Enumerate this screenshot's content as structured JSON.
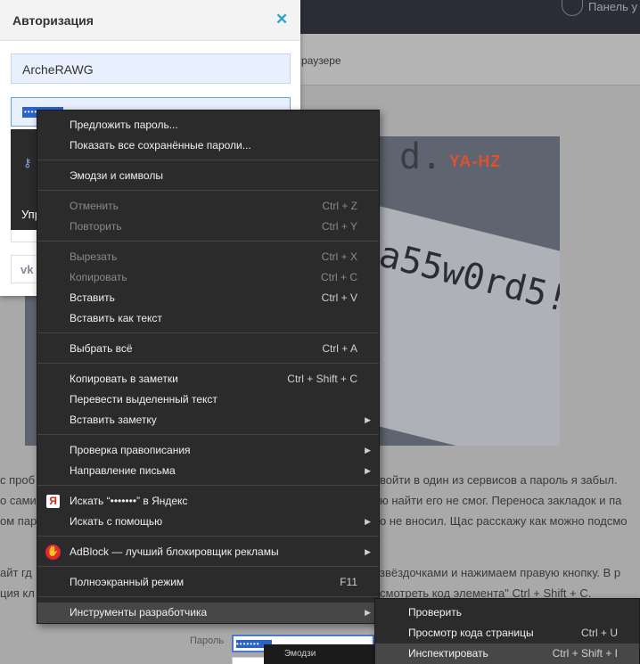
{
  "topbar": {
    "panel_link": "Панель у"
  },
  "page": {
    "tab_text": "раузере",
    "image": {
      "watermark": "YA-HZ",
      "password_text": "a55w0rd5!",
      "partial_text": "d."
    },
    "paragraphs": [
      {
        "left": "с проб",
        "right": "войти в один из сервисов а пароль я забыл."
      },
      {
        "left": "о сами",
        "right": "ю найти его не смог. Переноса закладок и па"
      },
      {
        "left": "ом пар",
        "right": "о не вносил. Щас расскажу как можно подсмо"
      },
      {
        "left": "айт гд",
        "right": "звёздочками и нажимаем правую кнопку. В р"
      },
      {
        "left": "ция кл",
        "right": "смотреть код элемента\" Ctrl + Shift + C."
      }
    ],
    "form_label": "Пароль",
    "emoji_tooltip": "Эмодзи"
  },
  "dialog": {
    "title": "Авторизация",
    "close_icon": "close-icon",
    "login_value": "ArcheRAWG",
    "password_value": "•••••••",
    "vk_label": "vk",
    "autofill_manage": "Упр"
  },
  "context_menu": {
    "items": [
      {
        "label": "Предложить пароль...",
        "shortcut": ""
      },
      {
        "label": "Показать все сохранённые пароли...",
        "shortcut": ""
      },
      {
        "label": "Эмодзи и символы",
        "shortcut": ""
      },
      {
        "label": "Отменить",
        "shortcut": "Ctrl + Z",
        "disabled": true
      },
      {
        "label": "Повторить",
        "shortcut": "Ctrl + Y",
        "disabled": true
      },
      {
        "label": "Вырезать",
        "shortcut": "Ctrl + X",
        "disabled": true
      },
      {
        "label": "Копировать",
        "shortcut": "Ctrl + C",
        "disabled": true
      },
      {
        "label": "Вставить",
        "shortcut": "Ctrl + V"
      },
      {
        "label": "Вставить как текст",
        "shortcut": ""
      },
      {
        "label": "Выбрать всё",
        "shortcut": "Ctrl + A"
      },
      {
        "label": "Копировать в заметки",
        "shortcut": "Ctrl + Shift + C"
      },
      {
        "label": "Перевести выделенный текст",
        "shortcut": ""
      },
      {
        "label": "Вставить заметку",
        "submenu": true
      },
      {
        "label": "Проверка правописания",
        "submenu": true
      },
      {
        "label": "Направление письма",
        "submenu": true
      },
      {
        "label": "Искать “•••••••” в Яндекс",
        "icon": "yandex-icon"
      },
      {
        "label": "Искать с помощью",
        "submenu": true
      },
      {
        "label": "AdBlock — лучший блокировщик рекламы",
        "icon": "adblock-icon",
        "submenu": true
      },
      {
        "label": "Полноэкранный режим",
        "shortcut": "F11"
      },
      {
        "label": "Инструменты разработчика",
        "submenu": true,
        "highlighted": true
      }
    ]
  },
  "dev_submenu": {
    "items": [
      {
        "label": "Проверить",
        "shortcut": ""
      },
      {
        "label": "Просмотр кода страницы",
        "shortcut": "Ctrl + U"
      },
      {
        "label": "Инспектировать",
        "shortcut": "Ctrl + Shift + I",
        "highlighted": true
      }
    ]
  },
  "colors": {
    "menu_bg": "#2b2b2b",
    "accent_blue": "#2a64c9",
    "close_teal": "#2aa4cc",
    "adblock_red": "#e4292c"
  }
}
